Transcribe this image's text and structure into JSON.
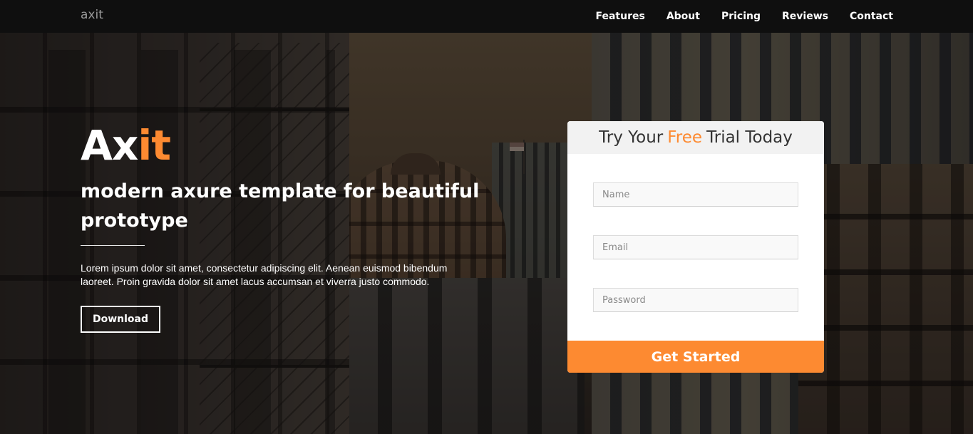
{
  "navbar": {
    "brand": "axit",
    "links": [
      "Features",
      "About",
      "Pricing",
      "Reviews",
      "Contact"
    ]
  },
  "hero": {
    "title_main": "Ax",
    "title_accent": "it",
    "subtitle": "modern axure template for beautiful prototype",
    "text": "Lorem ipsum dolor sit amet, consectetur adipiscing elit. Aenean euismod bibendum laoreet. Proin gravida dolor sit amet lacus accumsan et viverra justo commodo.",
    "download_label": "Download"
  },
  "trial_form": {
    "heading_before": "Try Your",
    "heading_accent": "Free",
    "heading_after": "Trial Today",
    "name_placeholder": "Name",
    "email_placeholder": "Email",
    "password_placeholder": "Password",
    "submit_label": "Get Started"
  },
  "colors": {
    "accent": "#fd8a31",
    "navbar_bg": "#0f0f0f",
    "text_light": "#ffffff"
  }
}
